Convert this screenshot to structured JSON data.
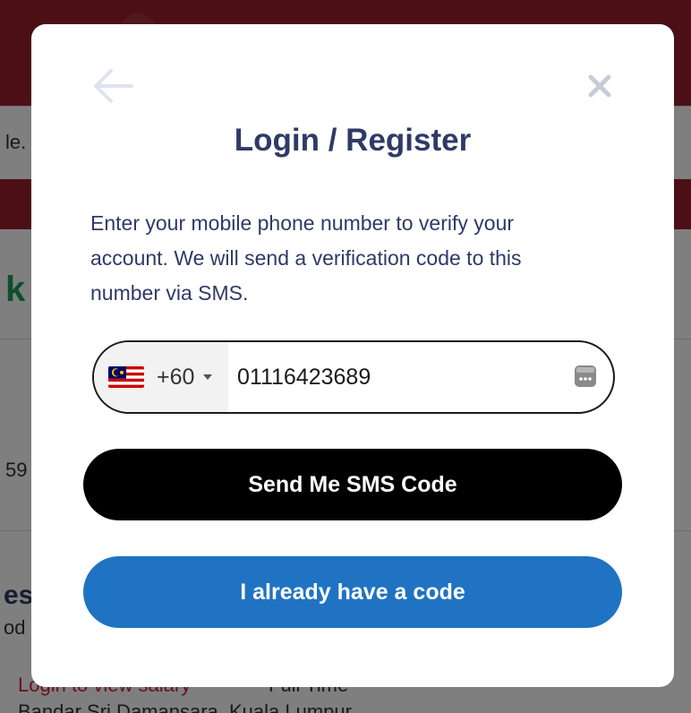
{
  "background": {
    "fragments": {
      "le": "le.",
      "num59": "59",
      "res": "es",
      "od": "od",
      "login_salary": "Login to view salary",
      "full_time": "Full Time",
      "location": "Bandar Sri Damansara, Kuala Lumpur"
    }
  },
  "modal": {
    "title": "Login / Register",
    "description": "Enter your mobile phone number to verify your account. We will send a verification code to this number via SMS.",
    "phone": {
      "country_flag": "malaysia-flag",
      "dial_code": "+60",
      "number_value": "01116423689",
      "number_placeholder": ""
    },
    "buttons": {
      "send_sms": "Send Me SMS Code",
      "have_code": "I already have a code"
    },
    "icons": {
      "back": "arrow-left-icon",
      "close": "close-icon",
      "autofill": "password-autofill-icon"
    }
  },
  "colors": {
    "brand_red": "#9b1e2d",
    "title_navy": "#2f3a66",
    "primary_black": "#000000",
    "secondary_blue": "#1f73c2"
  }
}
